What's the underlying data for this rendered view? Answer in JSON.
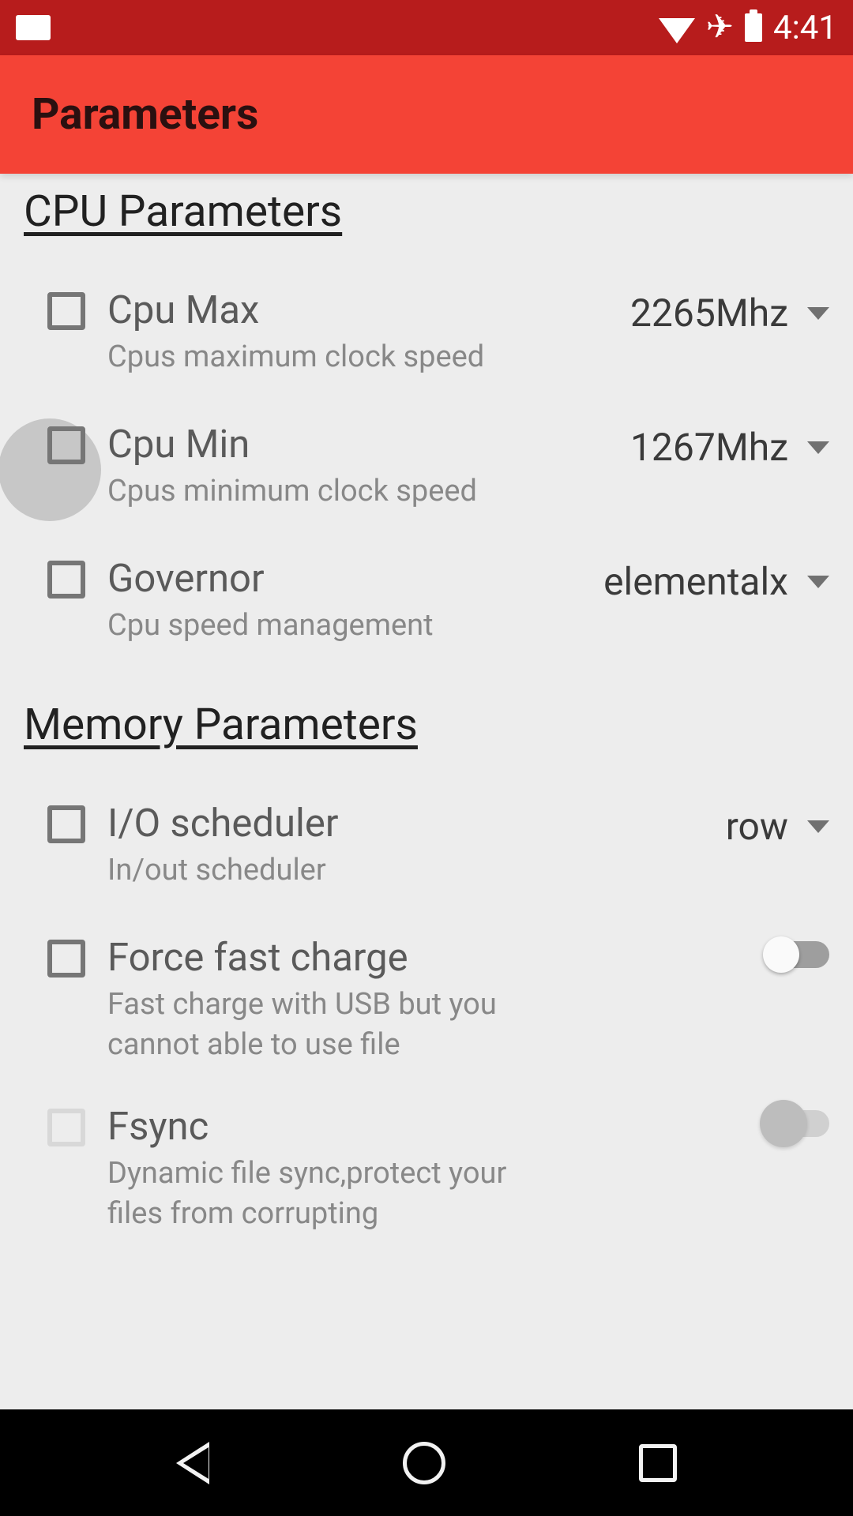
{
  "status": {
    "time": "4:41"
  },
  "appbar": {
    "title": "Parameters"
  },
  "sections": {
    "cpu": {
      "header": "CPU Parameters",
      "items": [
        {
          "title": "Cpu Max",
          "subtitle": "Cpus maximum clock speed",
          "value": "2265Mhz"
        },
        {
          "title": "Cpu Min",
          "subtitle": "Cpus minimum clock speed",
          "value": "1267Mhz"
        },
        {
          "title": "Governor",
          "subtitle": "Cpu speed management",
          "value": "elementalx"
        }
      ]
    },
    "memory": {
      "header": "Memory Parameters",
      "items": [
        {
          "title": "I/O scheduler",
          "subtitle": "In/out scheduler",
          "value": "row"
        },
        {
          "title": "Force fast charge",
          "subtitle": "Fast charge with USB but you cannot able to use file"
        },
        {
          "title": "Fsync",
          "subtitle": "Dynamic file sync,protect your files from corrupting"
        }
      ]
    }
  }
}
